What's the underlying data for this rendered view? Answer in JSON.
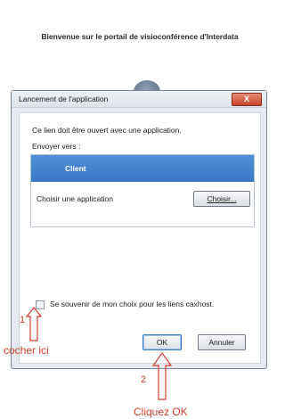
{
  "page": {
    "header": "Bienvenue sur le portail de visioconférence d'Interdata"
  },
  "dialog": {
    "title": "Lancement de l'application",
    "close_glyph": "X",
    "prompt": "Ce lien doit être ouvert avec une application.",
    "send_to_label": "Envoyer vers :",
    "apps": [
      {
        "label": "Client",
        "selected": true
      },
      {
        "label": "Choisir une application",
        "button_label": "Choisir..."
      }
    ],
    "remember_label": "Se souvenir de mon choix pour les liens caxhost.",
    "remember_checked": false,
    "ok_label": "OK",
    "cancel_label": "Annuler"
  },
  "annotations": {
    "step1_number": "1",
    "step1_text": "cocher ici",
    "step2_number": "2",
    "step2_text": "Cliquez OK",
    "color": "#d63a2b"
  }
}
